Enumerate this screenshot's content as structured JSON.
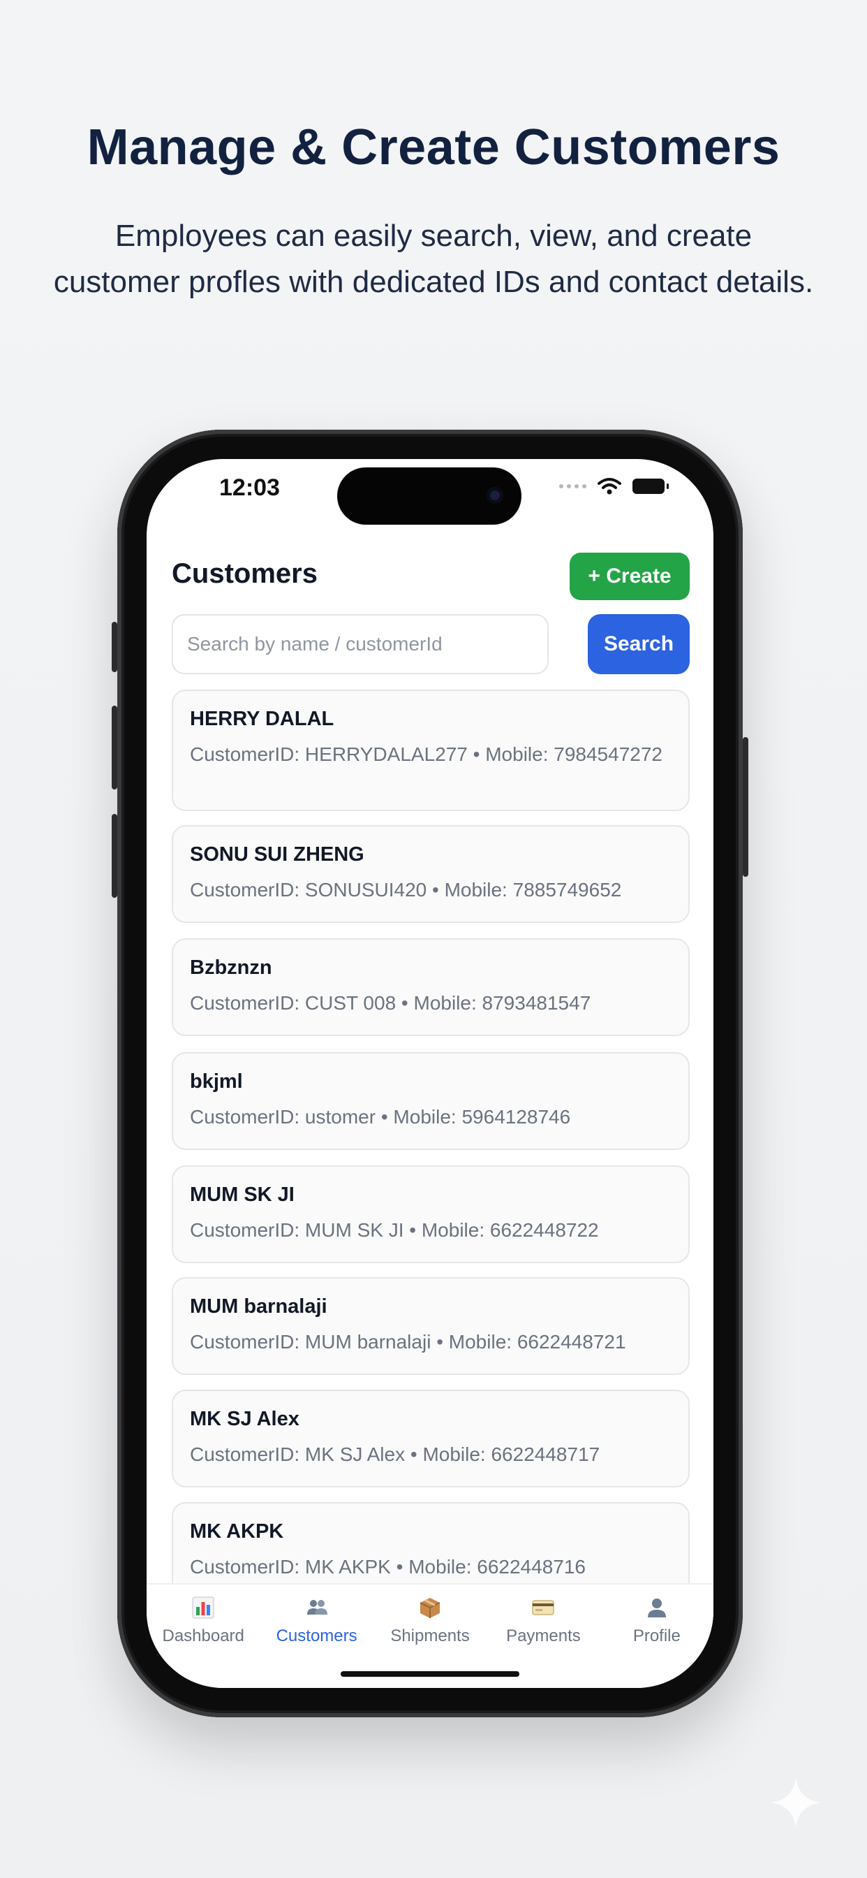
{
  "hero": {
    "title": "Manage & Create Customers",
    "subtitle_line1": "Employees can easily search, view, and create",
    "subtitle_line2": "customer profles with dedicated IDs and contact details."
  },
  "status_bar": {
    "time": "12:03"
  },
  "app": {
    "title": "Customers",
    "create_label": "+ Create",
    "search_placeholder": "Search by name / customerId",
    "search_value": "",
    "search_label": "Search"
  },
  "customers": [
    {
      "name": "HERRY DALAL",
      "meta": "CustomerID: HERRYDALAL277 • Mobile: 7984547272"
    },
    {
      "name": "SONU SUI ZHENG",
      "meta": "CustomerID: SONUSUI420 • Mobile: 7885749652"
    },
    {
      "name": "Bzbznzn",
      "meta": "CustomerID: CUST 008 • Mobile: 8793481547"
    },
    {
      "name": "bkjml",
      "meta": "CustomerID: ustomer • Mobile: 5964128746"
    },
    {
      "name": "MUM SK JI",
      "meta": "CustomerID: MUM SK JI • Mobile: 6622448722"
    },
    {
      "name": "MUM barnalaji",
      "meta": "CustomerID: MUM barnalaji • Mobile: 6622448721"
    },
    {
      "name": "MK SJ Alex",
      "meta": "CustomerID: MK SJ Alex • Mobile: 6622448717"
    },
    {
      "name": "MK AKPK",
      "meta": "CustomerID: MK AKPK • Mobile: 6622448716"
    }
  ],
  "nav": [
    {
      "label": "Dashboard",
      "icon": "bar-chart-icon"
    },
    {
      "label": "Customers",
      "icon": "users-icon",
      "active": true
    },
    {
      "label": "Shipments",
      "icon": "package-icon"
    },
    {
      "label": "Payments",
      "icon": "credit-card-icon"
    },
    {
      "label": "Profile",
      "icon": "user-icon"
    }
  ],
  "colors": {
    "primary": "#2b63e0",
    "create_green": "#22a447",
    "title_navy": "#12213f"
  }
}
